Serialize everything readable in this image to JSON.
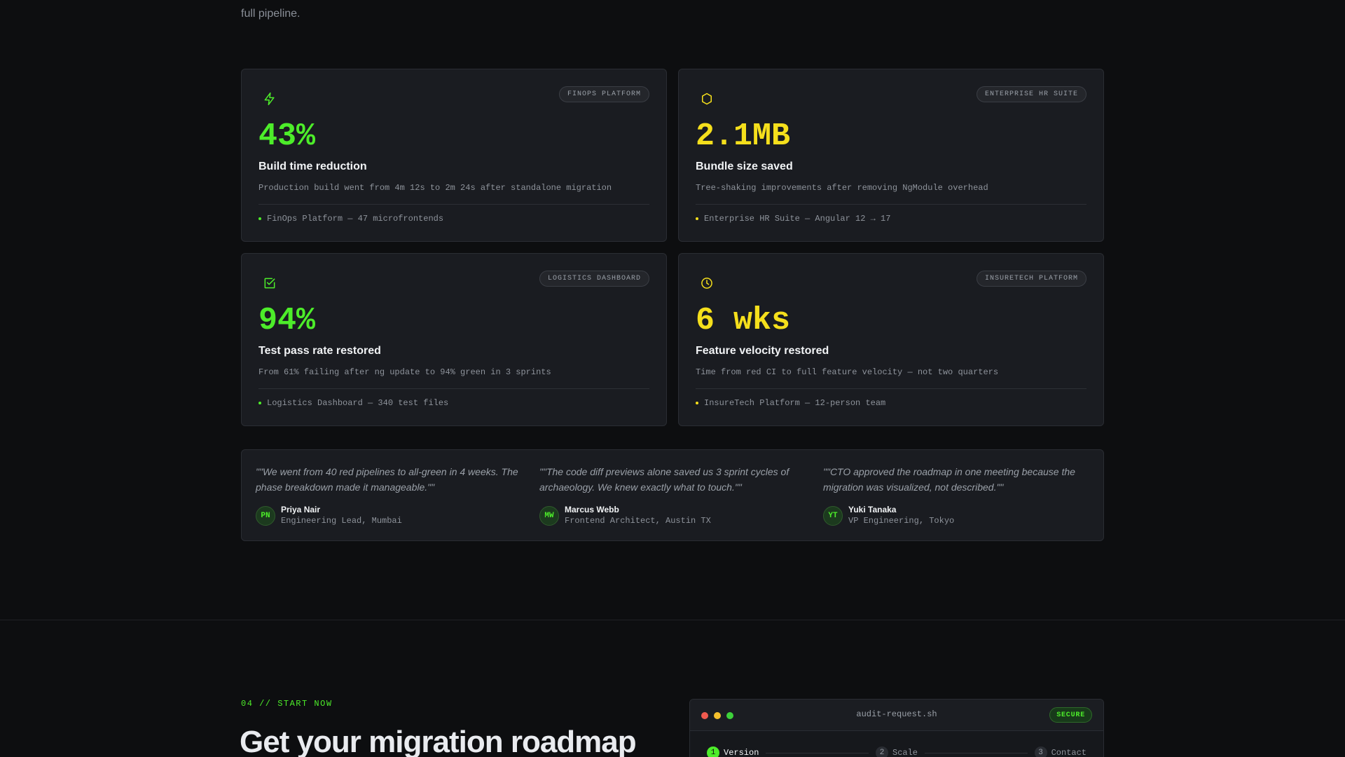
{
  "intro_text": "full pipeline.",
  "colors": {
    "green": "#4ded2a",
    "yellow": "#f5df1c"
  },
  "cards": [
    {
      "icon": "bolt-icon",
      "badge": "FINOPS PLATFORM",
      "metric": "43%",
      "title": "Build time reduction",
      "desc": "Production build went from 4m 12s to 2m 24s after standalone migration",
      "foot": "FinOps Platform — 47 microfrontends",
      "accent": "green"
    },
    {
      "icon": "hexagon-icon",
      "badge": "ENTERPRISE HR SUITE",
      "metric": "2.1MB",
      "title": "Bundle size saved",
      "desc": "Tree-shaking improvements after removing NgModule overhead",
      "foot": "Enterprise HR Suite — Angular 12 → 17",
      "accent": "yellow"
    },
    {
      "icon": "checkbox-icon",
      "badge": "LOGISTICS DASHBOARD",
      "metric": "94%",
      "title": "Test pass rate restored",
      "desc": "From 61% failing after ng update to 94% green in 3 sprints",
      "foot": "Logistics Dashboard — 340 test files",
      "accent": "green"
    },
    {
      "icon": "clock-icon",
      "badge": "INSURETECH PLATFORM",
      "metric": "6 wks",
      "title": "Feature velocity restored",
      "desc": "Time from red CI to full feature velocity — not two quarters",
      "foot": "InsureTech Platform — 12-person team",
      "accent": "yellow"
    }
  ],
  "testimonials": [
    {
      "quote": "\"\"We went from 40 red pipelines to all-green in 4 weeks. The phase breakdown made it manageable.\"\"",
      "initials": "PN",
      "name": "Priya Nair",
      "role": "Engineering Lead, Mumbai"
    },
    {
      "quote": "\"\"The code diff previews alone saved us 3 sprint cycles of archaeology. We knew exactly what to touch.\"\"",
      "initials": "MW",
      "name": "Marcus Webb",
      "role": "Frontend Architect, Austin TX"
    },
    {
      "quote": "\"\"CTO approved the roadmap in one meeting because the migration was visualized, not described.\"\"",
      "initials": "YT",
      "name": "Yuki Tanaka",
      "role": "VP Engineering, Tokyo"
    }
  ],
  "cta": {
    "eyebrow": "04 // START NOW",
    "headline": "Get your migration roadmap"
  },
  "terminal": {
    "title": "audit-request.sh",
    "badge": "SECURE",
    "steps": [
      {
        "num": "1",
        "label": "Version",
        "active": true
      },
      {
        "num": "2",
        "label": "Scale",
        "active": false
      },
      {
        "num": "3",
        "label": "Contact",
        "active": false
      }
    ]
  }
}
